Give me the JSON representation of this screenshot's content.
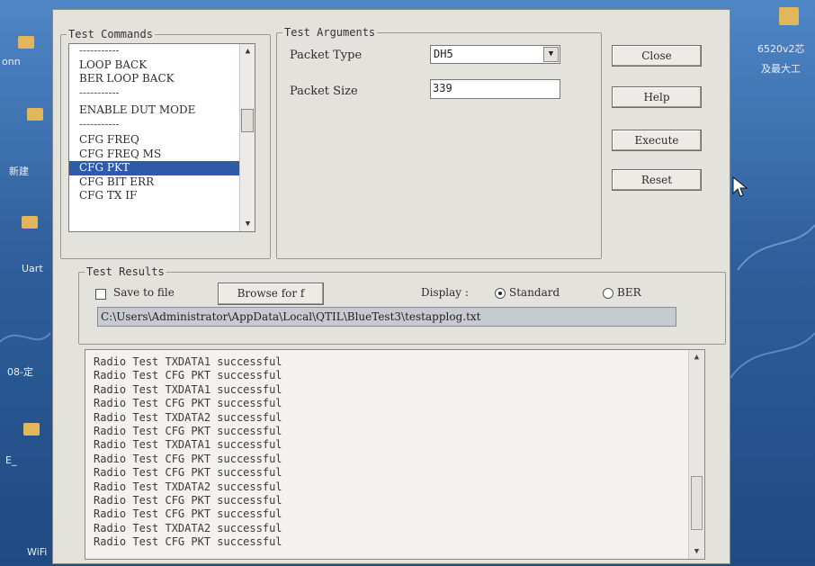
{
  "desktop": {
    "labels": [
      "onn",
      "Uart",
      "08-定",
      "新建",
      "E_",
      "WiFi",
      "6520v2芯",
      "及最大工"
    ]
  },
  "test_commands": {
    "legend": "Test Commands",
    "items": [
      {
        "label": "-----------",
        "separator": true
      },
      {
        "label": "LOOP BACK"
      },
      {
        "label": "BER LOOP BACK"
      },
      {
        "label": "-----------",
        "separator": true
      },
      {
        "label": "ENABLE DUT MODE"
      },
      {
        "label": "-----------",
        "separator": true
      },
      {
        "label": "CFG FREQ"
      },
      {
        "label": "CFG FREQ MS"
      },
      {
        "label": "CFG PKT",
        "selected": true
      },
      {
        "label": "CFG BIT ERR"
      },
      {
        "label": "CFG TX IF"
      }
    ]
  },
  "test_arguments": {
    "legend": "Test Arguments",
    "packet_type_label": "Packet Type",
    "packet_type_value": "DH5",
    "packet_size_label": "Packet Size",
    "packet_size_value": "339"
  },
  "buttons": {
    "close": "Close",
    "help": "Help",
    "execute": "Execute",
    "reset": "Reset"
  },
  "test_results": {
    "legend": "Test Results",
    "save_to_file": "Save to file",
    "browse": "Browse for f",
    "display_label": "Display :",
    "standard": "Standard",
    "ber": "BER",
    "display_selected": "Standard",
    "path": "C:\\Users\\Administrator\\AppData\\Local\\QTIL\\BlueTest3\\testapplog.txt"
  },
  "log": {
    "lines": [
      "Radio Test TXDATA1 successful",
      "Radio Test CFG PKT successful",
      "Radio Test TXDATA1 successful",
      "Radio Test CFG PKT successful",
      "Radio Test TXDATA2 successful",
      "Radio Test CFG PKT successful",
      "Radio Test TXDATA1 successful",
      "Radio Test CFG PKT successful",
      "Radio Test CFG PKT successful",
      "Radio Test TXDATA2 successful",
      "Radio Test CFG PKT successful",
      "Radio Test CFG PKT successful",
      "Radio Test TXDATA2 successful",
      "Radio Test CFG PKT successful"
    ]
  },
  "colors": {
    "selection": "#2f5aa8",
    "dialog_bg": "#e4e2dc",
    "desktop_bg": "#2f5f9c"
  }
}
